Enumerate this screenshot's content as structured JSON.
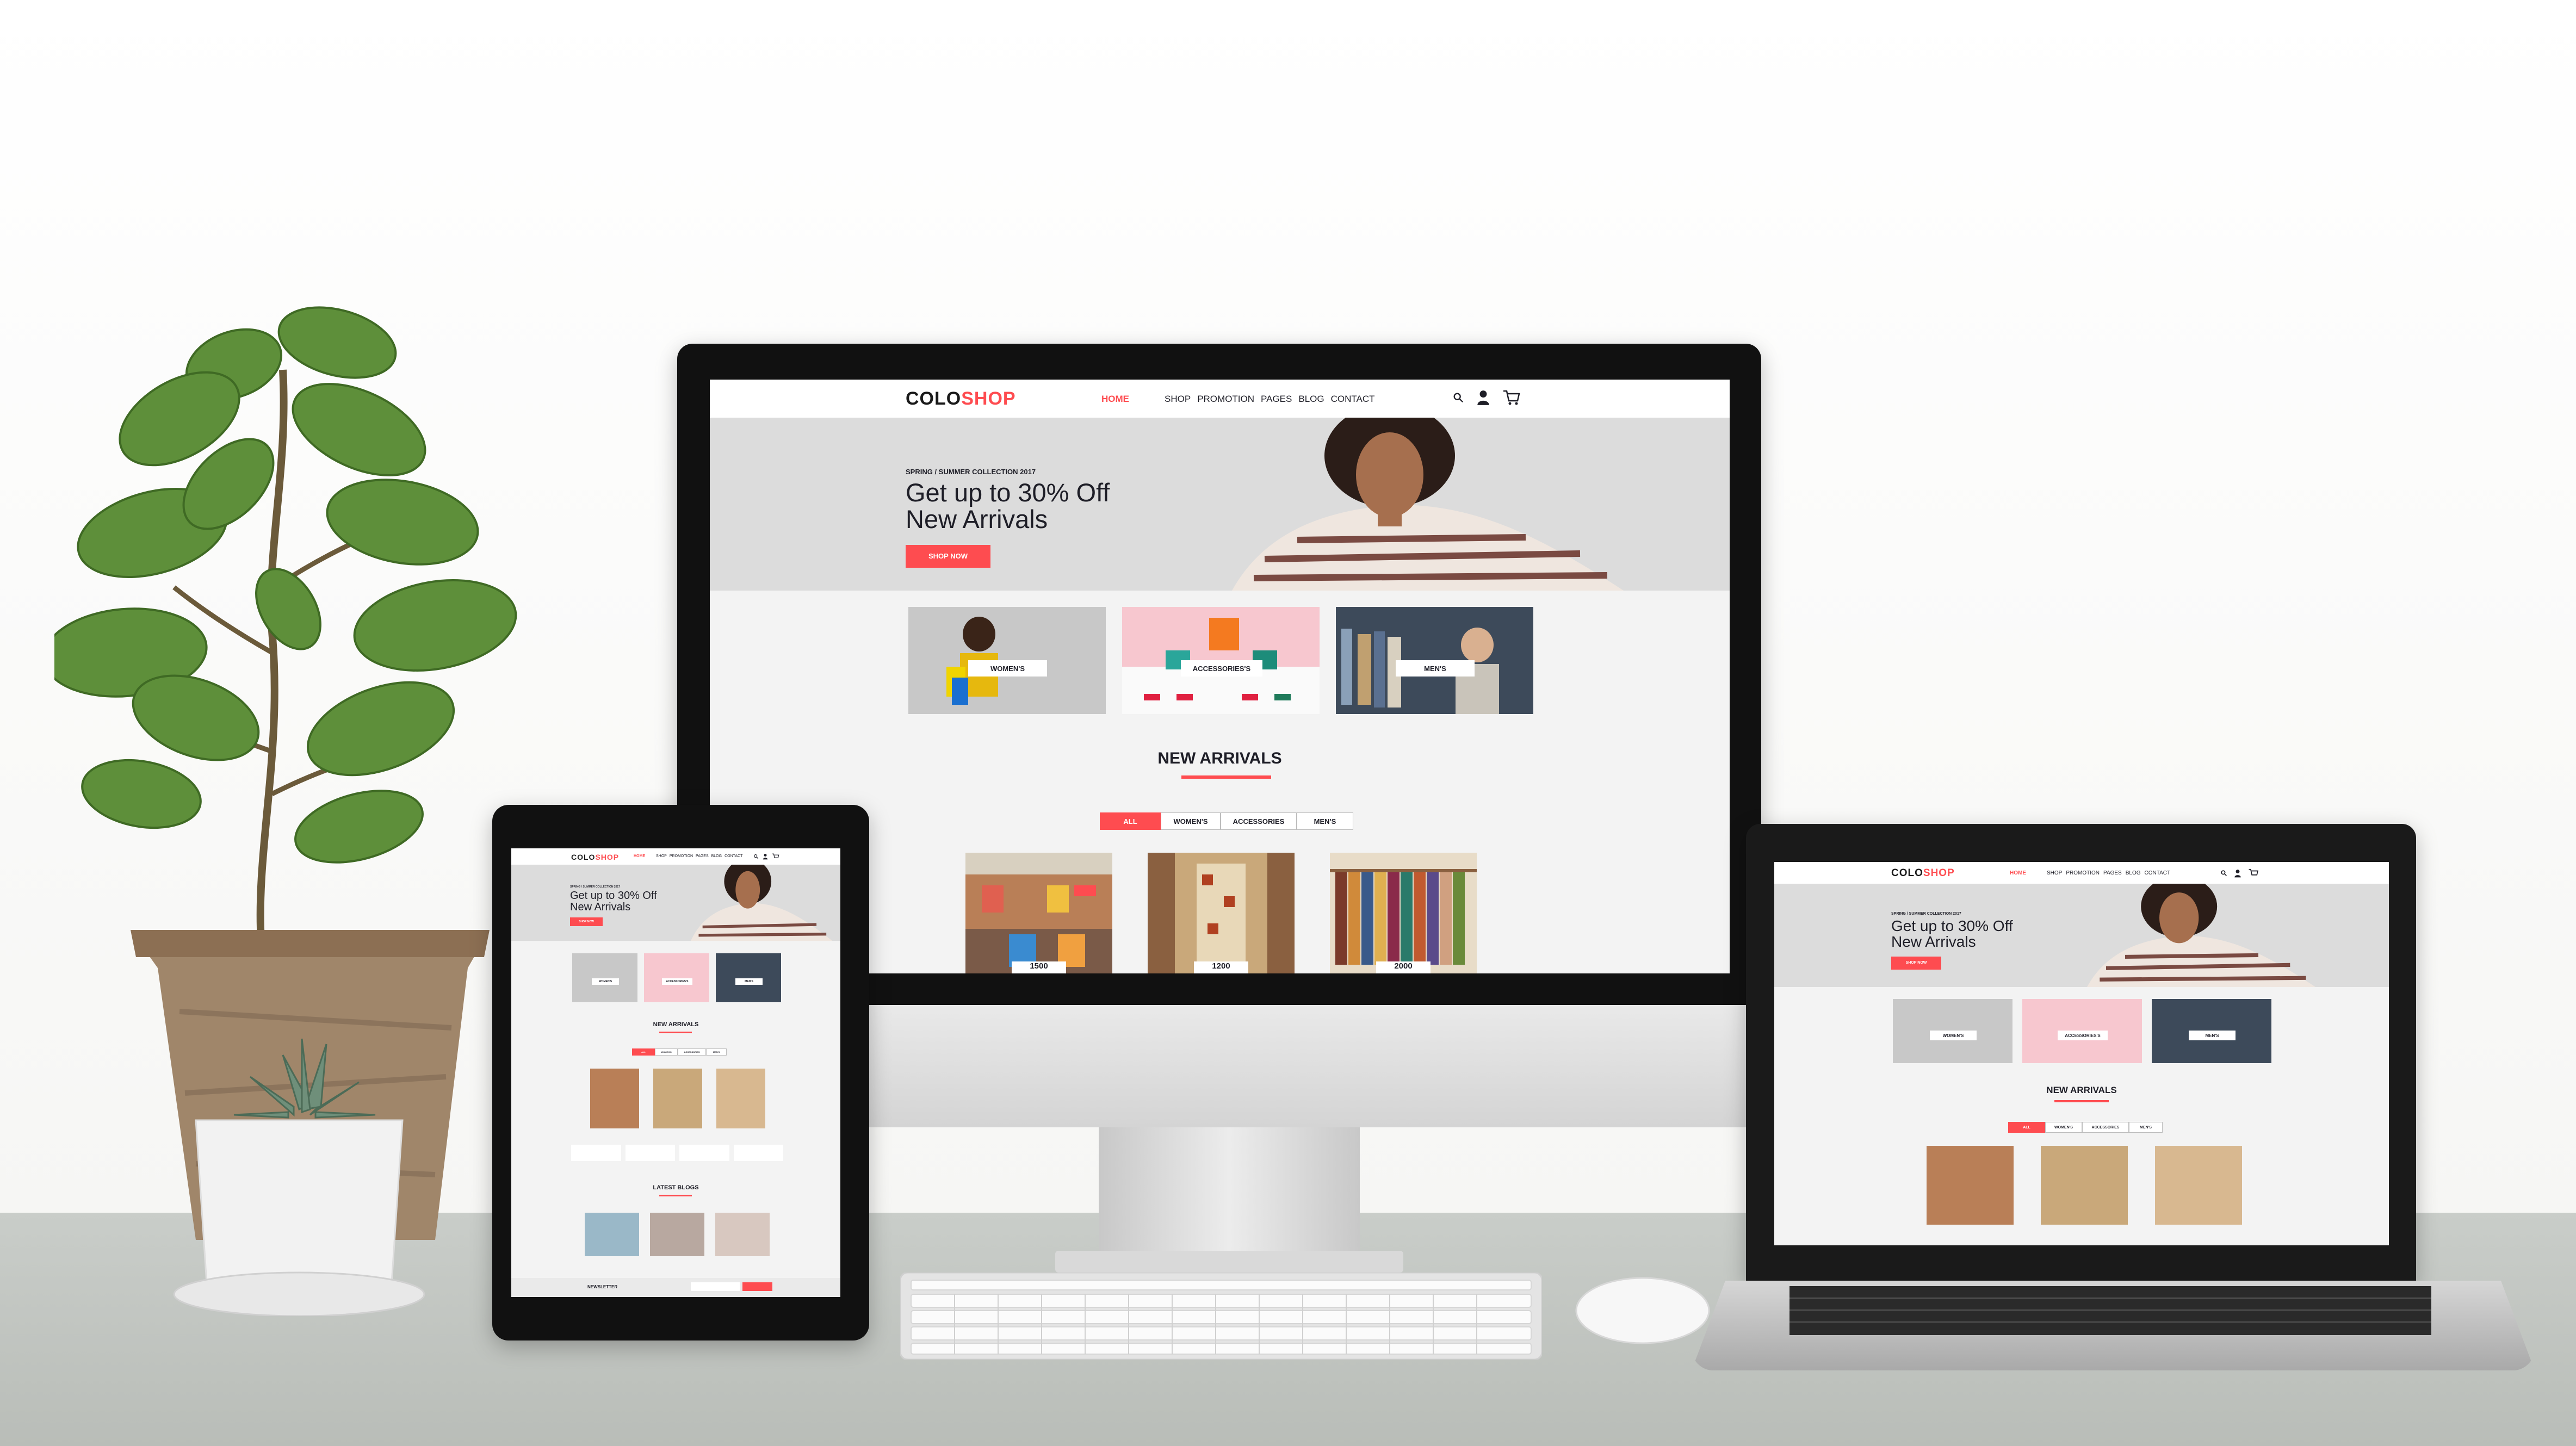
{
  "site": {
    "logo_part1": "COLO",
    "logo_part2": "SHOP",
    "nav": [
      "HOME",
      "SHOP",
      "PROMOTION",
      "PAGES",
      "BLOG",
      "CONTACT"
    ],
    "hero": {
      "subtitle": "SPRING / SUMMER COLLECTION 2017",
      "title_line1": "Get up to 30% Off",
      "title_line2": "New Arrivals",
      "button": "SHOP NOW"
    },
    "banners": [
      "WOMEN'S",
      "ACCESSORIES'S",
      "MEN'S"
    ],
    "new_arrivals_title": "NEW ARRIVALS",
    "filters": [
      "ALL",
      "WOMEN'S",
      "ACCESSORIES",
      "MEN'S"
    ],
    "prices": [
      "1500",
      "1200",
      "2000"
    ],
    "latest_blogs_title": "LATEST BLOGS",
    "newsletter_title": "NEWSLETTER"
  },
  "colors": {
    "accent": "#fe4c50",
    "text": "#1e1e27",
    "hero_bg": "#dcdcdc"
  },
  "icons": [
    "search-icon",
    "user-icon",
    "cart-icon"
  ]
}
